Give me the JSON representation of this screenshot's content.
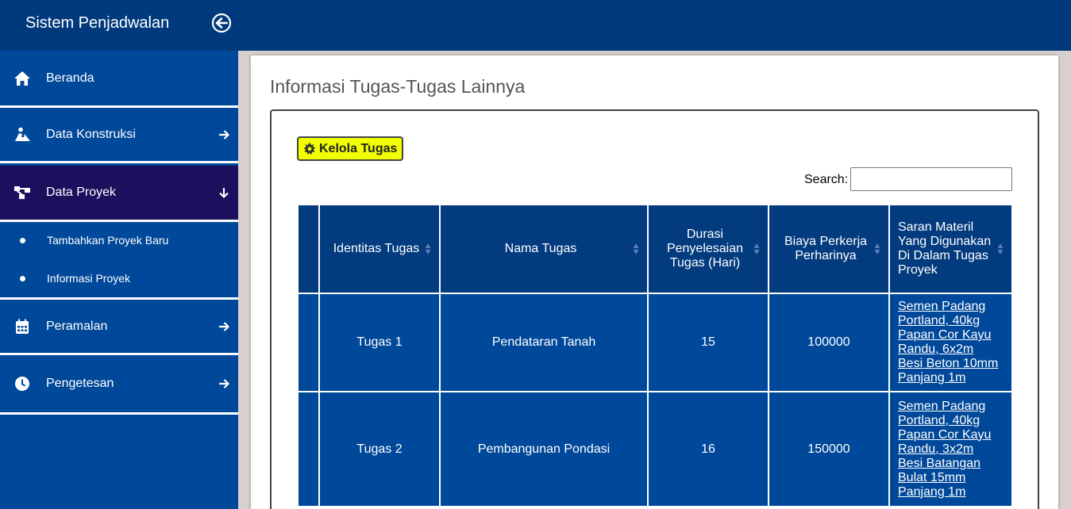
{
  "app": {
    "title": "Sistem Penjadwalan"
  },
  "sidebar": {
    "items": [
      {
        "label": "Beranda",
        "icon": "home-icon"
      },
      {
        "label": "Data Konstruksi",
        "icon": "worker-icon"
      },
      {
        "label": "Data Proyek",
        "icon": "project-tree-icon"
      },
      {
        "label": "Peramalan",
        "icon": "calendar-icon"
      },
      {
        "label": "Pengetesan",
        "icon": "clock-icon"
      }
    ],
    "subitems": [
      {
        "label": "Tambahkan Proyek Baru"
      },
      {
        "label": "Informasi Proyek"
      }
    ]
  },
  "main": {
    "title": "Informasi Tugas-Tugas Lainnya",
    "manage_button": "Kelola Tugas",
    "search_label": "Search:",
    "search_value": "",
    "table": {
      "headers": [
        "",
        "Identitas Tugas",
        "Nama Tugas",
        "Durasi Penyelesaian Tugas (Hari)",
        "Biaya Perkerja Perharinya",
        "Saran Materil Yang Digunakan Di Dalam Tugas Proyek"
      ],
      "rows": [
        {
          "id": "Tugas 1",
          "name": "Pendataran Tanah",
          "duration": "15",
          "cost": "100000",
          "materials": [
            "Semen Padang Portland, 40kg",
            "Papan Cor Kayu Randu, 6x2m",
            "Besi Beton 10mm Panjang 1m"
          ]
        },
        {
          "id": "Tugas 2",
          "name": "Pembangunan Pondasi",
          "duration": "16",
          "cost": "150000",
          "materials": [
            "Semen Padang Portland, 40kg",
            "Papan Cor Kayu Randu, 3x2m",
            "Besi Batangan Bulat 15mm Panjang 1m"
          ]
        }
      ]
    }
  },
  "colors": {
    "topbar": "#003a7d",
    "sidebar": "#004899",
    "sidebar_active": "#1b0f5e",
    "table_header": "#023b7e",
    "table_cell": "#004899",
    "button": "#f2ff00"
  }
}
